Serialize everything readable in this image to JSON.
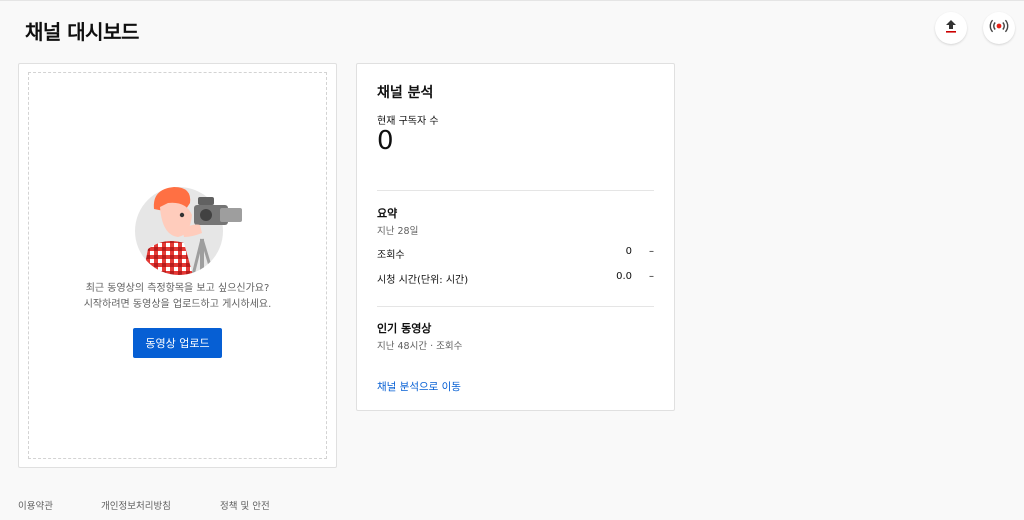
{
  "header": {
    "title": "채널 대시보드",
    "upload_icon": "upload-icon",
    "live_icon": "live-broadcast-icon"
  },
  "empty_state": {
    "line1": "최근 동영상의 측정항목을 보고 싶으신가요?",
    "line2": "시작하려면 동영상을 업로드하고 게시하세요.",
    "upload_button": "동영상 업로드"
  },
  "analytics": {
    "title": "채널 분석",
    "subscribers_label": "현재 구독자 수",
    "subscribers_value": "0",
    "summary": {
      "title": "요약",
      "period": "지난 28일",
      "rows": [
        {
          "label": "조회수",
          "value": "0",
          "trend": "–"
        },
        {
          "label": "시청 시간(단위: 시간)",
          "value": "0.0",
          "trend": "–"
        }
      ]
    },
    "top_videos": {
      "title": "인기 동영상",
      "subtitle": "지난 48시간 · 조회수"
    },
    "link": "채널 분석으로 이동"
  },
  "footer": {
    "links": [
      "이용약관",
      "개인정보처리방침",
      "정책 및 안전"
    ]
  },
  "colors": {
    "accent": "#065fd4",
    "upload_underline": "#cc0000",
    "live_red": "#e62117"
  }
}
